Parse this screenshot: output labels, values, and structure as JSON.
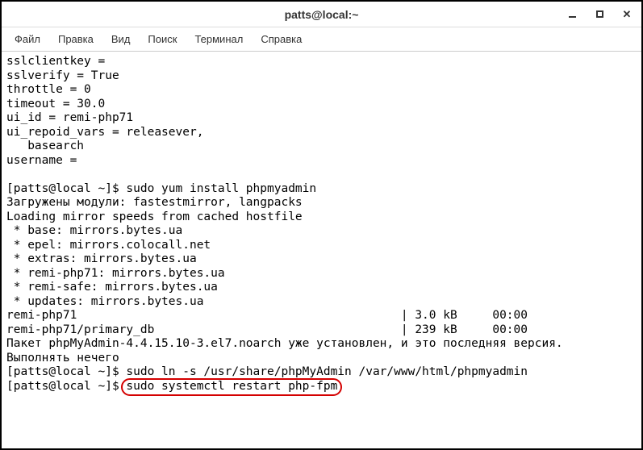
{
  "window": {
    "title": "patts@local:~"
  },
  "menu": {
    "file": "Файл",
    "edit": "Правка",
    "view": "Вид",
    "search": "Поиск",
    "terminal": "Терминал",
    "help": "Справка"
  },
  "terminal": {
    "lines": {
      "l1": "sslclientkey =",
      "l2": "sslverify = True",
      "l3": "throttle = 0",
      "l4": "timeout = 30.0",
      "l5": "ui_id = remi-php71",
      "l6": "ui_repoid_vars = releasever,",
      "l7": "   basearch",
      "l8": "username =",
      "l9": "",
      "prompt1": "[patts@local ~]$ ",
      "cmd1": "sudo yum install phpmyadmin",
      "l11": "Загружены модули: fastestmirror, langpacks",
      "l12": "Loading mirror speeds from cached hostfile",
      "l13": " * base: mirrors.bytes.ua",
      "l14": " * epel: mirrors.colocall.net",
      "l15": " * extras: mirrors.bytes.ua",
      "l16": " * remi-php71: mirrors.bytes.ua",
      "l17": " * remi-safe: mirrors.bytes.ua",
      "l18": " * updates: mirrors.bytes.ua",
      "l19": "remi-php71                                              | 3.0 kB     00:00",
      "l20": "remi-php71/primary_db                                   | 239 kB     00:00",
      "l21": "Пакет phpMyAdmin-4.4.15.10-3.el7.noarch уже установлен, и это последняя версия.",
      "l22": "Выполнять нечего",
      "prompt2": "[patts@local ~]$ ",
      "cmd2": "sudo ln -s /usr/share/phpMyAdmin /var/www/html/phpmyadmin",
      "prompt3": "[patts@local ~]$ ",
      "cmd3": "sudo systemctl restart php-fpm"
    }
  }
}
